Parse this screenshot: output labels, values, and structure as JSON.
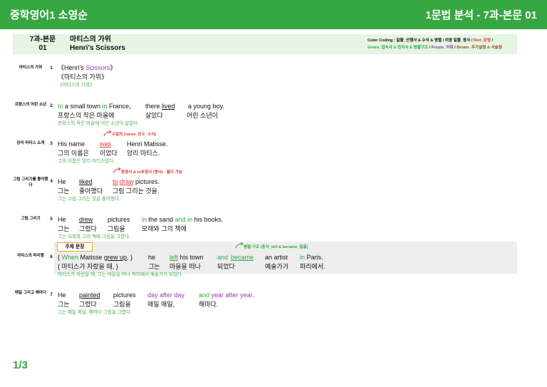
{
  "header": {
    "left_title": "중학영어1 소영순",
    "right_title": "1문법 분석 - 7과-본문 01"
  },
  "lesson_bar": {
    "lesson_line1": "7과-본문",
    "lesson_line2": "01",
    "title_line1": "마티스의 가위",
    "title_line2": "Henri's Scissors",
    "legend_prefix": "Color Coding : 밑줄_선행사 & 수식 & 병렬 / 이중 밑줄_동사 / ",
    "legend_red": "Red_문법",
    "legend_sep": " / ",
    "legend_green": "Green_접속사 & 전치사 & 병렬구조",
    "legend_purple": "Purple_어휘",
    "legend_brown": "Brown_추가설명 & 서술형"
  },
  "rows": [
    {
      "label": "마티스의 가위",
      "num": "1",
      "en_a": "《Henri's ",
      "en_b": "Scissors",
      "en_c": "》",
      "ko": "《마티스의 가위》",
      "tr": "《마티스의 가위》"
    },
    {
      "label": "프랑스의 어린 소년",
      "num": "2",
      "en": [
        "In",
        " a small town ",
        "in",
        " France,",
        "there ",
        "lived",
        "a young boy."
      ],
      "ko": [
        "프랑스의 작은 마을에",
        "살았다",
        "어린 소년이"
      ],
      "tr": "프랑스의 작은 마을에 어린 소년이 살았다."
    },
    {
      "label": "앙리 마티스 소개",
      "num": "3",
      "en": [
        "His name",
        "was",
        "Henri Matisse."
      ],
      "ko": [
        "그의 이름은",
        "이었다",
        "앙리 마티스."
      ],
      "tr": "그의 이름은 앙리 마티스였다.",
      "note": "수일치 (name_단수_수식)"
    },
    {
      "label": "그림 그리기를 좋아했다",
      "num": "4",
      "en": [
        "He",
        "liked",
        "to",
        "draw",
        " pictures."
      ],
      "ko": [
        "그는",
        "좋아했다",
        "그림 그리는 것을."
      ],
      "tr": "그는 그림 그리는 것을 좋아했다.",
      "note": "동명사 & to부정사 (명사) - 둘다 가능"
    },
    {
      "label": "그림 그리기",
      "num": "5",
      "en": [
        "He",
        "drew",
        "pictures",
        "in",
        " the sand ",
        "and",
        " ",
        "in",
        " his books."
      ],
      "ko": [
        "그는",
        "그렸다",
        "그림을",
        "모래와 그의 책에"
      ],
      "tr": "그는 모래와 그의 책에 그림을 그렸다."
    },
    {
      "label": "마티스의 파리행",
      "num": "6",
      "topic": "주제 문장",
      "note": "병렬 구조 (동사_left & became_일출)",
      "en": [
        "{ ",
        "When",
        " Matisse ",
        "grew up",
        ", }",
        "he",
        "left",
        " his town",
        "and",
        "became",
        "an artist",
        "in",
        " Paris."
      ],
      "ko": [
        "{ 마티스가 자랐을 때, }",
        "그는",
        "마을을 떠나",
        "되었다",
        "예술가가",
        "파리에서."
      ],
      "tr": "마티스가 자랐을 때, 그는 마을을 떠나 파리에서 예술가가 되었다."
    },
    {
      "label": "매일 그리고 해마다",
      "num": "7",
      "en": [
        "He",
        "painted",
        "pictures",
        "day after day",
        "and",
        "year after year",
        "."
      ],
      "ko": [
        "그는",
        "그렸다",
        "그림을",
        "매일 매일,",
        "해마다."
      ],
      "tr": "그는 매일 매일, 해마다 그림을 그렸다."
    }
  ],
  "footer": {
    "page": "1/3"
  },
  "colors": {
    "header": "#35a641",
    "band": "#e6f4e2",
    "grammar": "#e53935",
    "connector": "#2eaa3a",
    "vocab": "#8a3fb8",
    "topic_box": "#f5a623"
  }
}
